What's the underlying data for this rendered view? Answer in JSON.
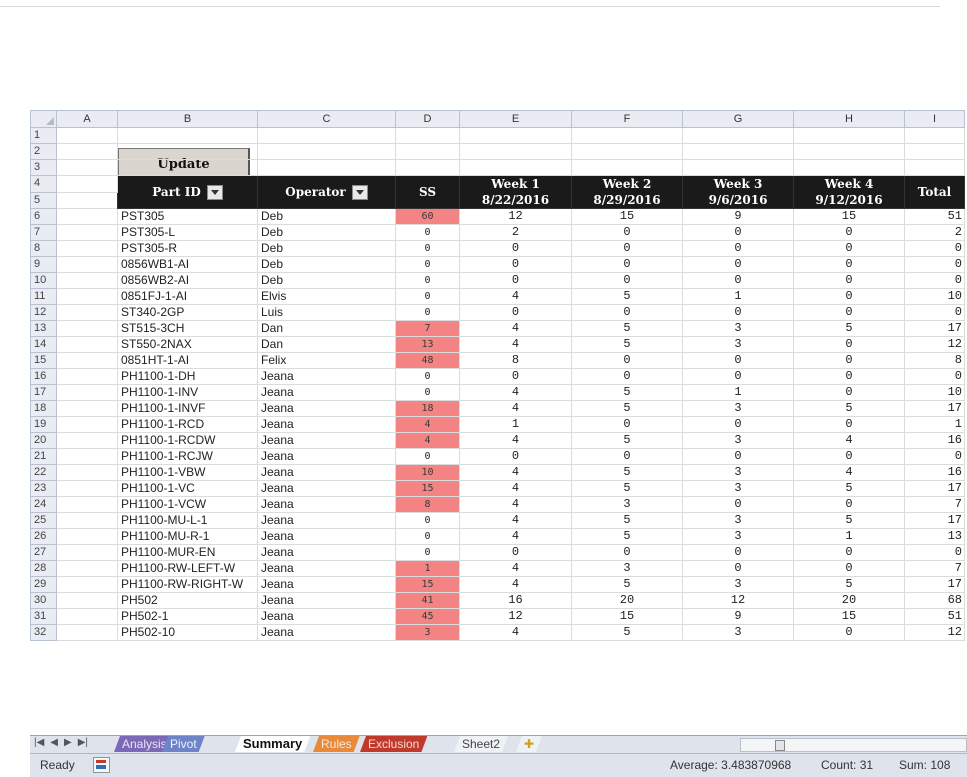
{
  "columns": [
    "",
    "A",
    "B",
    "C",
    "D",
    "E",
    "F",
    "G",
    "H",
    "I"
  ],
  "header": {
    "part_id": "Part ID",
    "operator": "Operator",
    "ss": "SS",
    "week1": "Week 1",
    "week1_date": "8/22/2016",
    "week2": "Week 2",
    "week2_date": "8/29/2016",
    "week3": "Week 3",
    "week3_date": "9/6/2016",
    "week4": "Week 4",
    "week4_date": "9/12/2016",
    "total": "Total"
  },
  "update_button": "Update",
  "rows": [
    {
      "n": "6",
      "part": "PST305",
      "op": "Deb",
      "ss": "60",
      "hl": true,
      "w1": "12",
      "w2": "15",
      "w3": "9",
      "w4": "15",
      "tot": "51"
    },
    {
      "n": "7",
      "part": "PST305-L",
      "op": "Deb",
      "ss": "0",
      "hl": false,
      "w1": "2",
      "w2": "0",
      "w3": "0",
      "w4": "0",
      "tot": "2"
    },
    {
      "n": "8",
      "part": "PST305-R",
      "op": "Deb",
      "ss": "0",
      "hl": false,
      "w1": "0",
      "w2": "0",
      "w3": "0",
      "w4": "0",
      "tot": "0"
    },
    {
      "n": "9",
      "part": "0856WB1-AI",
      "op": "Deb",
      "ss": "0",
      "hl": false,
      "w1": "0",
      "w2": "0",
      "w3": "0",
      "w4": "0",
      "tot": "0"
    },
    {
      "n": "10",
      "part": "0856WB2-AI",
      "op": "Deb",
      "ss": "0",
      "hl": false,
      "w1": "0",
      "w2": "0",
      "w3": "0",
      "w4": "0",
      "tot": "0"
    },
    {
      "n": "11",
      "part": "0851FJ-1-AI",
      "op": "Elvis",
      "ss": "0",
      "hl": false,
      "w1": "4",
      "w2": "5",
      "w3": "1",
      "w4": "0",
      "tot": "10"
    },
    {
      "n": "12",
      "part": "ST340-2GP",
      "op": "Luis",
      "ss": "0",
      "hl": false,
      "w1": "0",
      "w2": "0",
      "w3": "0",
      "w4": "0",
      "tot": "0"
    },
    {
      "n": "13",
      "part": "ST515-3CH",
      "op": "Dan",
      "ss": "7",
      "hl": true,
      "w1": "4",
      "w2": "5",
      "w3": "3",
      "w4": "5",
      "tot": "17"
    },
    {
      "n": "14",
      "part": "ST550-2NAX",
      "op": "Dan",
      "ss": "13",
      "hl": true,
      "w1": "4",
      "w2": "5",
      "w3": "3",
      "w4": "0",
      "tot": "12"
    },
    {
      "n": "15",
      "part": "0851HT-1-AI",
      "op": "Felix",
      "ss": "48",
      "hl": true,
      "w1": "8",
      "w2": "0",
      "w3": "0",
      "w4": "0",
      "tot": "8"
    },
    {
      "n": "16",
      "part": "PH1100-1-DH",
      "op": "Jeana",
      "ss": "0",
      "hl": false,
      "w1": "0",
      "w2": "0",
      "w3": "0",
      "w4": "0",
      "tot": "0"
    },
    {
      "n": "17",
      "part": "PH1100-1-INV",
      "op": "Jeana",
      "ss": "0",
      "hl": false,
      "w1": "4",
      "w2": "5",
      "w3": "1",
      "w4": "0",
      "tot": "10"
    },
    {
      "n": "18",
      "part": "PH1100-1-INVF",
      "op": "Jeana",
      "ss": "18",
      "hl": true,
      "w1": "4",
      "w2": "5",
      "w3": "3",
      "w4": "5",
      "tot": "17"
    },
    {
      "n": "19",
      "part": "PH1100-1-RCD",
      "op": "Jeana",
      "ss": "4",
      "hl": true,
      "w1": "1",
      "w2": "0",
      "w3": "0",
      "w4": "0",
      "tot": "1"
    },
    {
      "n": "20",
      "part": "PH1100-1-RCDW",
      "op": "Jeana",
      "ss": "4",
      "hl": true,
      "w1": "4",
      "w2": "5",
      "w3": "3",
      "w4": "4",
      "tot": "16"
    },
    {
      "n": "21",
      "part": "PH1100-1-RCJW",
      "op": "Jeana",
      "ss": "0",
      "hl": false,
      "w1": "0",
      "w2": "0",
      "w3": "0",
      "w4": "0",
      "tot": "0"
    },
    {
      "n": "22",
      "part": "PH1100-1-VBW",
      "op": "Jeana",
      "ss": "10",
      "hl": true,
      "w1": "4",
      "w2": "5",
      "w3": "3",
      "w4": "4",
      "tot": "16"
    },
    {
      "n": "23",
      "part": "PH1100-1-VC",
      "op": "Jeana",
      "ss": "15",
      "hl": true,
      "w1": "4",
      "w2": "5",
      "w3": "3",
      "w4": "5",
      "tot": "17"
    },
    {
      "n": "24",
      "part": "PH1100-1-VCW",
      "op": "Jeana",
      "ss": "8",
      "hl": true,
      "w1": "4",
      "w2": "3",
      "w3": "0",
      "w4": "0",
      "tot": "7"
    },
    {
      "n": "25",
      "part": "PH1100-MU-L-1",
      "op": "Jeana",
      "ss": "0",
      "hl": false,
      "w1": "4",
      "w2": "5",
      "w3": "3",
      "w4": "5",
      "tot": "17"
    },
    {
      "n": "26",
      "part": "PH1100-MU-R-1",
      "op": "Jeana",
      "ss": "0",
      "hl": false,
      "w1": "4",
      "w2": "5",
      "w3": "3",
      "w4": "1",
      "tot": "13"
    },
    {
      "n": "27",
      "part": "PH1100-MUR-EN",
      "op": "Jeana",
      "ss": "0",
      "hl": false,
      "w1": "0",
      "w2": "0",
      "w3": "0",
      "w4": "0",
      "tot": "0"
    },
    {
      "n": "28",
      "part": "PH1100-RW-LEFT-W",
      "op": "Jeana",
      "ss": "1",
      "hl": true,
      "w1": "4",
      "w2": "3",
      "w3": "0",
      "w4": "0",
      "tot": "7"
    },
    {
      "n": "29",
      "part": "PH1100-RW-RIGHT-W",
      "op": "Jeana",
      "ss": "15",
      "hl": true,
      "w1": "4",
      "w2": "5",
      "w3": "3",
      "w4": "5",
      "tot": "17"
    },
    {
      "n": "30",
      "part": "PH502",
      "op": "Jeana",
      "ss": "41",
      "hl": true,
      "w1": "16",
      "w2": "20",
      "w3": "12",
      "w4": "20",
      "tot": "68"
    },
    {
      "n": "31",
      "part": "PH502-1",
      "op": "Jeana",
      "ss": "45",
      "hl": true,
      "w1": "12",
      "w2": "15",
      "w3": "9",
      "w4": "15",
      "tot": "51"
    },
    {
      "n": "32",
      "part": "PH502-10",
      "op": "Jeana",
      "ss": "3",
      "hl": true,
      "w1": "4",
      "w2": "5",
      "w3": "3",
      "w4": "0",
      "tot": "12"
    }
  ],
  "tabs": [
    {
      "label": "Analysis",
      "bg": "#7b68b6",
      "color": "#e8e4f6",
      "active": false
    },
    {
      "label": "Pivot",
      "bg": "#6e84c8",
      "color": "#eef2fb",
      "active": false
    },
    {
      "label": "Summary",
      "bg": "#ffffff",
      "color": "#111111",
      "active": true
    },
    {
      "label": "Rules",
      "bg": "#e88a3a",
      "color": "#fbe9d8",
      "active": false
    },
    {
      "label": "Exclusion",
      "bg": "#c0392b",
      "color": "#f6d8d4",
      "active": false
    },
    {
      "label": "Sheet2",
      "bg": "#eef1f5",
      "color": "#444444",
      "active": false
    }
  ],
  "status": {
    "ready": "Ready",
    "average": "Average: 3.483870968",
    "count": "Count: 31",
    "sum": "Sum: 108"
  },
  "colors": {
    "highlight": "#f48484",
    "header_bg": "#1a1a1a"
  }
}
